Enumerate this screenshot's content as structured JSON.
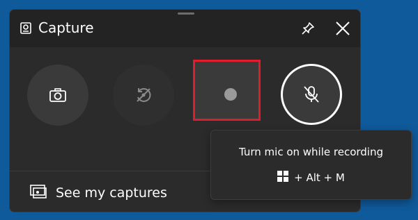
{
  "window": {
    "title": "Capture",
    "title_icon": "capture-widget-icon",
    "pin_icon": "pin-icon",
    "close_icon": "close-icon"
  },
  "controls": {
    "screenshot_icon": "camera-icon",
    "record_last_icon": "record-last-30-seconds-icon",
    "record_icon": "record-dot-icon",
    "mic_icon": "mic-off-icon"
  },
  "footer": {
    "captures_label": "See my captures",
    "captures_icon": "gallery-icon"
  },
  "tooltip": {
    "text": "Turn mic on while recording",
    "shortcut": "+ Alt + M",
    "shortcut_icon": "windows-logo-icon"
  },
  "colors": {
    "background": "#0f5a9b",
    "panel": "#2b2b2b",
    "highlight": "#e11d2d"
  }
}
